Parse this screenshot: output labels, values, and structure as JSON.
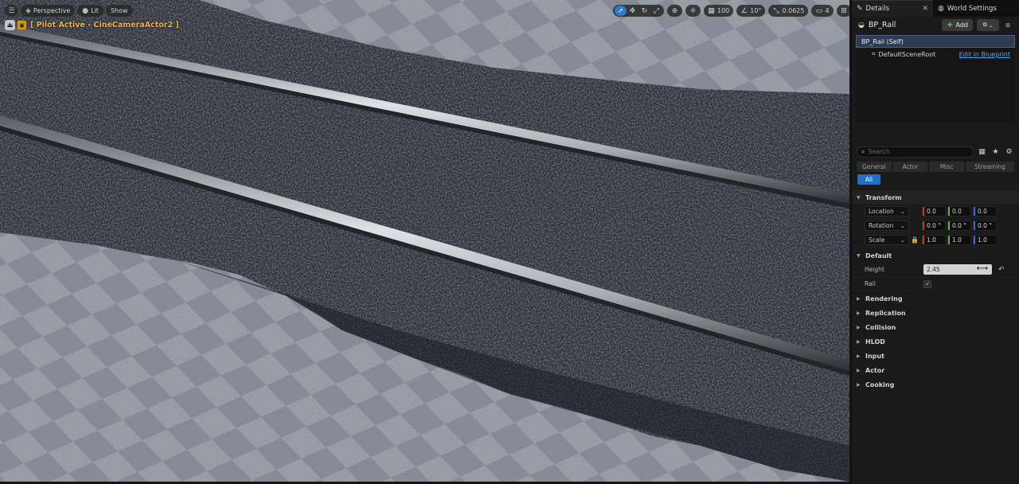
{
  "viewport": {
    "toolbar": {
      "perspective_label": "Perspective",
      "lit_label": "Lit",
      "show_label": "Show",
      "grid_snap_value": "100",
      "rotation_snap_value": "10°",
      "scale_snap_value": "0.0625",
      "camera_speed_value": "4"
    },
    "pilot_label": "[ Pilot Active - CineCameraActor2 ]"
  },
  "panel": {
    "tabs": [
      {
        "label": "Details"
      },
      {
        "label": "World Settings"
      }
    ],
    "actor_name": "BP_Rail",
    "add_label": "Add",
    "components": {
      "self_label": "BP_Rail (Self)",
      "root_label": "DefaultSceneRoot",
      "edit_link": "Edit in Blueprint"
    },
    "search": {
      "placeholder": "Search"
    },
    "filters": [
      "General",
      "Actor",
      "Misc",
      "Streaming"
    ],
    "all_label": "All",
    "transform": {
      "title": "Transform",
      "location": {
        "label": "Location",
        "x": "0.0",
        "y": "0.0",
        "z": "0.0"
      },
      "rotation": {
        "label": "Rotation",
        "x": "0.0 °",
        "y": "0.0 °",
        "z": "0.0 °"
      },
      "scale": {
        "label": "Scale",
        "x": "1.0",
        "y": "1.0",
        "z": "1.0"
      }
    },
    "default": {
      "title": "Default",
      "height_label": "Height",
      "height_value": "2.45",
      "rail_label": "Rail",
      "rail_checked": true
    },
    "sections": [
      "Rendering",
      "Replication",
      "Collision",
      "HLOD",
      "Input",
      "Actor",
      "Cooking"
    ]
  },
  "colors": {
    "accent": "#2a7bd6",
    "pilot_text": "#f0b23a",
    "axis_x": "#c8372d",
    "axis_y": "#6cb133",
    "axis_z": "#2e6ee8"
  }
}
